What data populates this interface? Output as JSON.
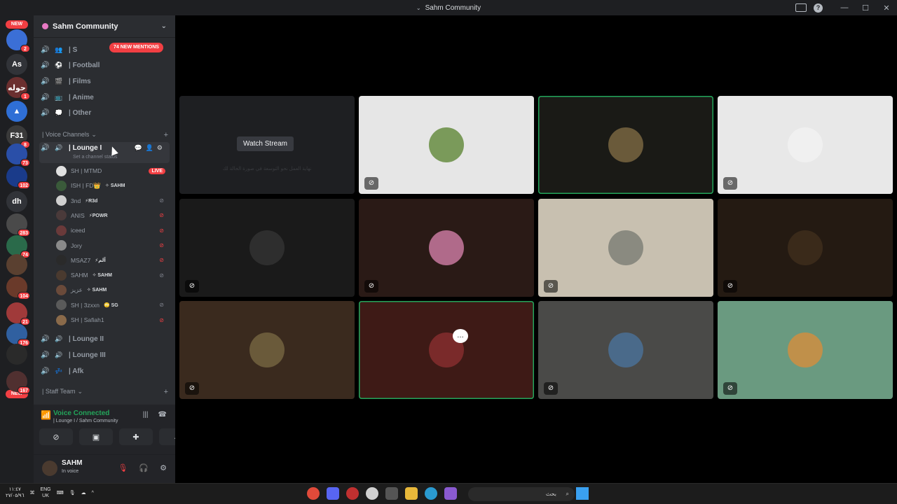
{
  "window": {
    "title": "Sahm Community"
  },
  "rail": {
    "new_top": "NEW",
    "new_bottom": "NEW",
    "servers": [
      {
        "label": "",
        "badge": "2",
        "color": "#3b6fd6"
      },
      {
        "label": "As",
        "badge": "",
        "color": "#313338"
      },
      {
        "label": "حوله",
        "badge": "1",
        "color": "#6b2f2f"
      },
      {
        "label": "▲",
        "badge": "",
        "color": "#2f6fd6"
      },
      {
        "label": "F31",
        "badge": "8",
        "color": "#3a3a3a"
      },
      {
        "label": "",
        "badge": "73",
        "color": "#2a4fa8"
      },
      {
        "label": "",
        "badge": "102",
        "color": "#1a3b8a"
      },
      {
        "label": "dh",
        "badge": "",
        "color": "#313338"
      },
      {
        "label": "",
        "badge": "283",
        "color": "#4a4a4a"
      },
      {
        "label": "",
        "badge": "74",
        "color": "#2a6a4a"
      },
      {
        "label": "",
        "badge": "",
        "color": "#5a4030"
      },
      {
        "label": "",
        "badge": "104",
        "color": "#6a3a2a"
      },
      {
        "label": "",
        "badge": "21",
        "color": "#a03a3a"
      },
      {
        "label": "",
        "badge": "176",
        "color": "#3060a0"
      },
      {
        "label": "",
        "badge": "",
        "color": "#2a2a2a"
      },
      {
        "label": "",
        "badge": "167",
        "color": "#503030"
      }
    ]
  },
  "guild": {
    "name": "Sahm Community",
    "new_mentions": "74 NEW MENTIONS"
  },
  "text_channels": [
    {
      "label": "| S",
      "icon": "👥"
    },
    {
      "label": "| Football",
      "icon": "⚽"
    },
    {
      "label": "| Films",
      "icon": "🎬"
    },
    {
      "label": "| Anime",
      "icon": "📺"
    },
    {
      "label": "| Other",
      "icon": "💭"
    }
  ],
  "voice_category": "| Voice Channels",
  "lounge": {
    "name": "| Lounge I",
    "status": "Set a channel status"
  },
  "voice_users": [
    {
      "name": "SH | MTMD",
      "tag": "",
      "state": "live",
      "color": "#e0e0e0"
    },
    {
      "name": "ISH | FD👑",
      "tag": "✧ SAHM",
      "state": "",
      "color": "#3a5a3a"
    },
    {
      "name": "3nd",
      "tag": "⚡R3d",
      "state": "deaf-grey",
      "color": "#d0d0d0"
    },
    {
      "name": "ANIS",
      "tag": "⚡POWR",
      "state": "deaf-red",
      "color": "#4a3a3a"
    },
    {
      "name": "iceed",
      "tag": "",
      "state": "deaf-red",
      "color": "#6a3a3a"
    },
    {
      "name": "Jory",
      "tag": "",
      "state": "deaf-red",
      "color": "#8a8a8a"
    },
    {
      "name": "MSAZ7",
      "tag": "⚡آلم",
      "state": "deaf-red",
      "color": "#2a2a2a"
    },
    {
      "name": "SAHM",
      "tag": "✧ SAHM",
      "state": "deaf-grey",
      "color": "#4a3a2f"
    },
    {
      "name": "عزيز",
      "tag": "✧ SAHM",
      "state": "",
      "color": "#6a4a3a"
    },
    {
      "name": "SH | 3zxxn",
      "tag": "🙄 SG",
      "state": "deaf-grey",
      "color": "#5a5a5a"
    },
    {
      "name": "SH | Safiah1",
      "tag": "",
      "state": "deaf-red",
      "color": "#8a6a4a"
    }
  ],
  "more_voice": [
    "| Lounge II",
    "| Lounge III",
    "| Afk"
  ],
  "staff_category": "| Staff Team",
  "voice_panel": {
    "title": "Voice Connected",
    "subtitle": "| Lounge I / Sahm Community"
  },
  "user": {
    "name": "SAHM",
    "status": "In voice"
  },
  "stage": {
    "watch_label": "Watch Stream",
    "stream_note": "نهاية العمل نحو التوسعة في صورة الحالة لك",
    "tiles": [
      {
        "bg": "#1e1f22",
        "avatar": "",
        "speaking": false,
        "mic": false,
        "stream": true
      },
      {
        "bg": "#e6e6e6",
        "avatar": "#7a9a5a",
        "speaking": false,
        "mic": true
      },
      {
        "bg": "#1a1a16",
        "avatar": "#6a5a3a",
        "speaking": true,
        "mic": false
      },
      {
        "bg": "#e8e8e8",
        "avatar": "#f0f0f0",
        "speaking": false,
        "mic": true
      },
      {
        "bg": "#1a1a1a",
        "avatar": "#2e2e2e",
        "speaking": false,
        "mic": true
      },
      {
        "bg": "#2a1a16",
        "avatar": "#b06a8a",
        "speaking": false,
        "mic": true
      },
      {
        "bg": "#c8c0b0",
        "avatar": "#8a8a80",
        "speaking": false,
        "mic": true
      },
      {
        "bg": "#241a12",
        "avatar": "#3a2a1a",
        "speaking": false,
        "mic": true
      },
      {
        "bg": "#3a2a1e",
        "avatar": "#6a5a3a",
        "speaking": false,
        "mic": true
      },
      {
        "bg": "#3e1a16",
        "avatar": "#7a2a2a",
        "speaking": true,
        "mic": false,
        "bubble": true
      },
      {
        "bg": "#4a4a48",
        "avatar": "#4a6a8a",
        "speaking": false,
        "mic": true
      },
      {
        "bg": "#6a9a80",
        "avatar": "#c0904a",
        "speaking": false,
        "mic": true
      }
    ]
  },
  "taskbar": {
    "time": "١١:٤٧",
    "date": "٢٧/٠٥/٩٦",
    "lang_top": "ENG",
    "lang_bottom": "UK",
    "search": "بحث"
  }
}
